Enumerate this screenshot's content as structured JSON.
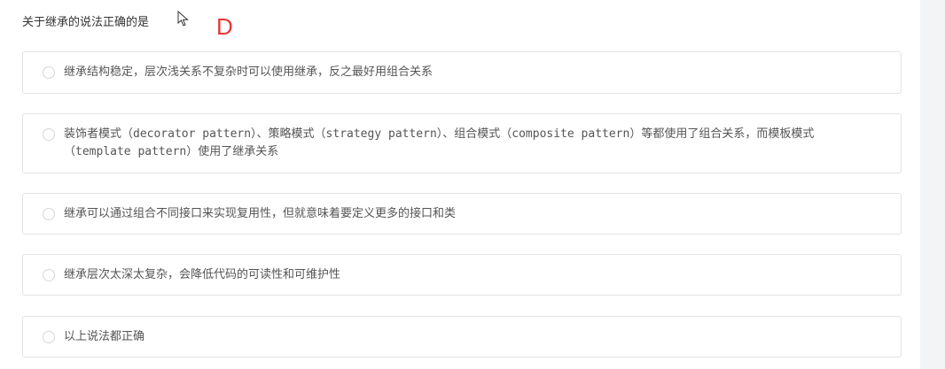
{
  "question": {
    "title": "关于继承的说法正确的是",
    "answer_mark": "D",
    "answer_mark_color": "#e53935"
  },
  "cursor": {
    "icon": "mouse-pointer-icon"
  },
  "options": [
    {
      "text": "继承结构稳定，层次浅关系不复杂时可以使用继承，反之最好用组合关系"
    },
    {
      "text": "装饰者模式（decorator pattern）、策略模式（strategy pattern）、组合模式（composite pattern）等都使用了组合关系，而模板模式（template pattern）使用了继承关系"
    },
    {
      "text": "继承可以通过组合不同接口来实现复用性，但就意味着要定义更多的接口和类"
    },
    {
      "text": "继承层次太深太复杂，会降低代码的可读性和可维护性"
    },
    {
      "text": "以上说法都正确"
    }
  ],
  "colors": {
    "border": "#e3e3e3",
    "text": "#555555",
    "gutter": "#f3f4f5"
  }
}
